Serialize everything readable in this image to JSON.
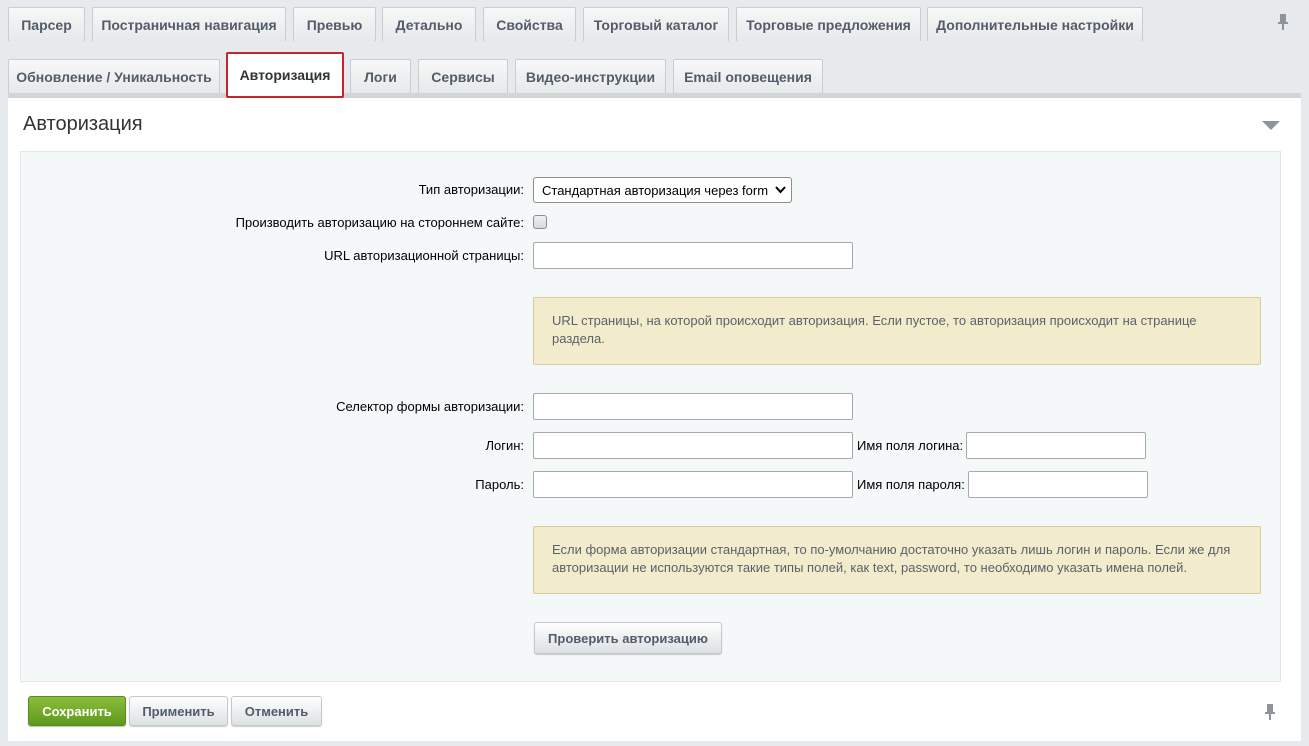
{
  "tabs_row1": [
    {
      "label": "Парсер"
    },
    {
      "label": "Постраничная навигация"
    },
    {
      "label": "Превью"
    },
    {
      "label": "Детально"
    },
    {
      "label": "Свойства"
    },
    {
      "label": "Торговый каталог"
    },
    {
      "label": "Торговые предложения"
    },
    {
      "label": "Дополнительные настройки"
    }
  ],
  "tabs_row2": [
    {
      "label": "Обновление / Уникальность"
    },
    {
      "label": "Авторизация",
      "active": true
    },
    {
      "label": "Логи"
    },
    {
      "label": "Сервисы"
    },
    {
      "label": "Видео-инструкции"
    },
    {
      "label": "Email оповещения"
    }
  ],
  "section": {
    "title": "Авторизация"
  },
  "form": {
    "auth_type_label": "Тип авторизации:",
    "auth_type_value": "Стандартная авторизация через form",
    "third_party_label": "Производить авторизацию на стороннем сайте:",
    "third_party_checked": false,
    "url_label": "URL авторизационной страницы:",
    "url_value": "",
    "url_note": "URL страницы, на которой происходит авторизация. Если пустое, то авторизация происходит на странице раздела.",
    "selector_label": "Селектор формы авторизации:",
    "selector_value": "",
    "login_label": "Логин:",
    "login_value": "",
    "login_field_label": "Имя поля логина:",
    "login_field_value": "",
    "password_label": "Пароль:",
    "password_value": "",
    "password_field_label": "Имя поля пароля:",
    "password_field_value": "",
    "fields_note": "Если форма авторизации стандартная, то по-умолчанию достаточно указать лишь логин и пароль. Если же для авторизации не используются такие типы полей, как text, password, то необходимо указать имена полей.",
    "check_button": "Проверить авторизацию"
  },
  "footer": {
    "save_label": "Сохранить",
    "apply_label": "Применить",
    "cancel_label": "Отменить"
  },
  "icons": {
    "pin": "pin-icon",
    "collapse": "triangle-down-icon",
    "select_arrow": "chevron-down-icon"
  },
  "colors": {
    "accent_red": "#c4242a",
    "save_green": "#6ea82b",
    "note_bg": "#f3eccc"
  }
}
